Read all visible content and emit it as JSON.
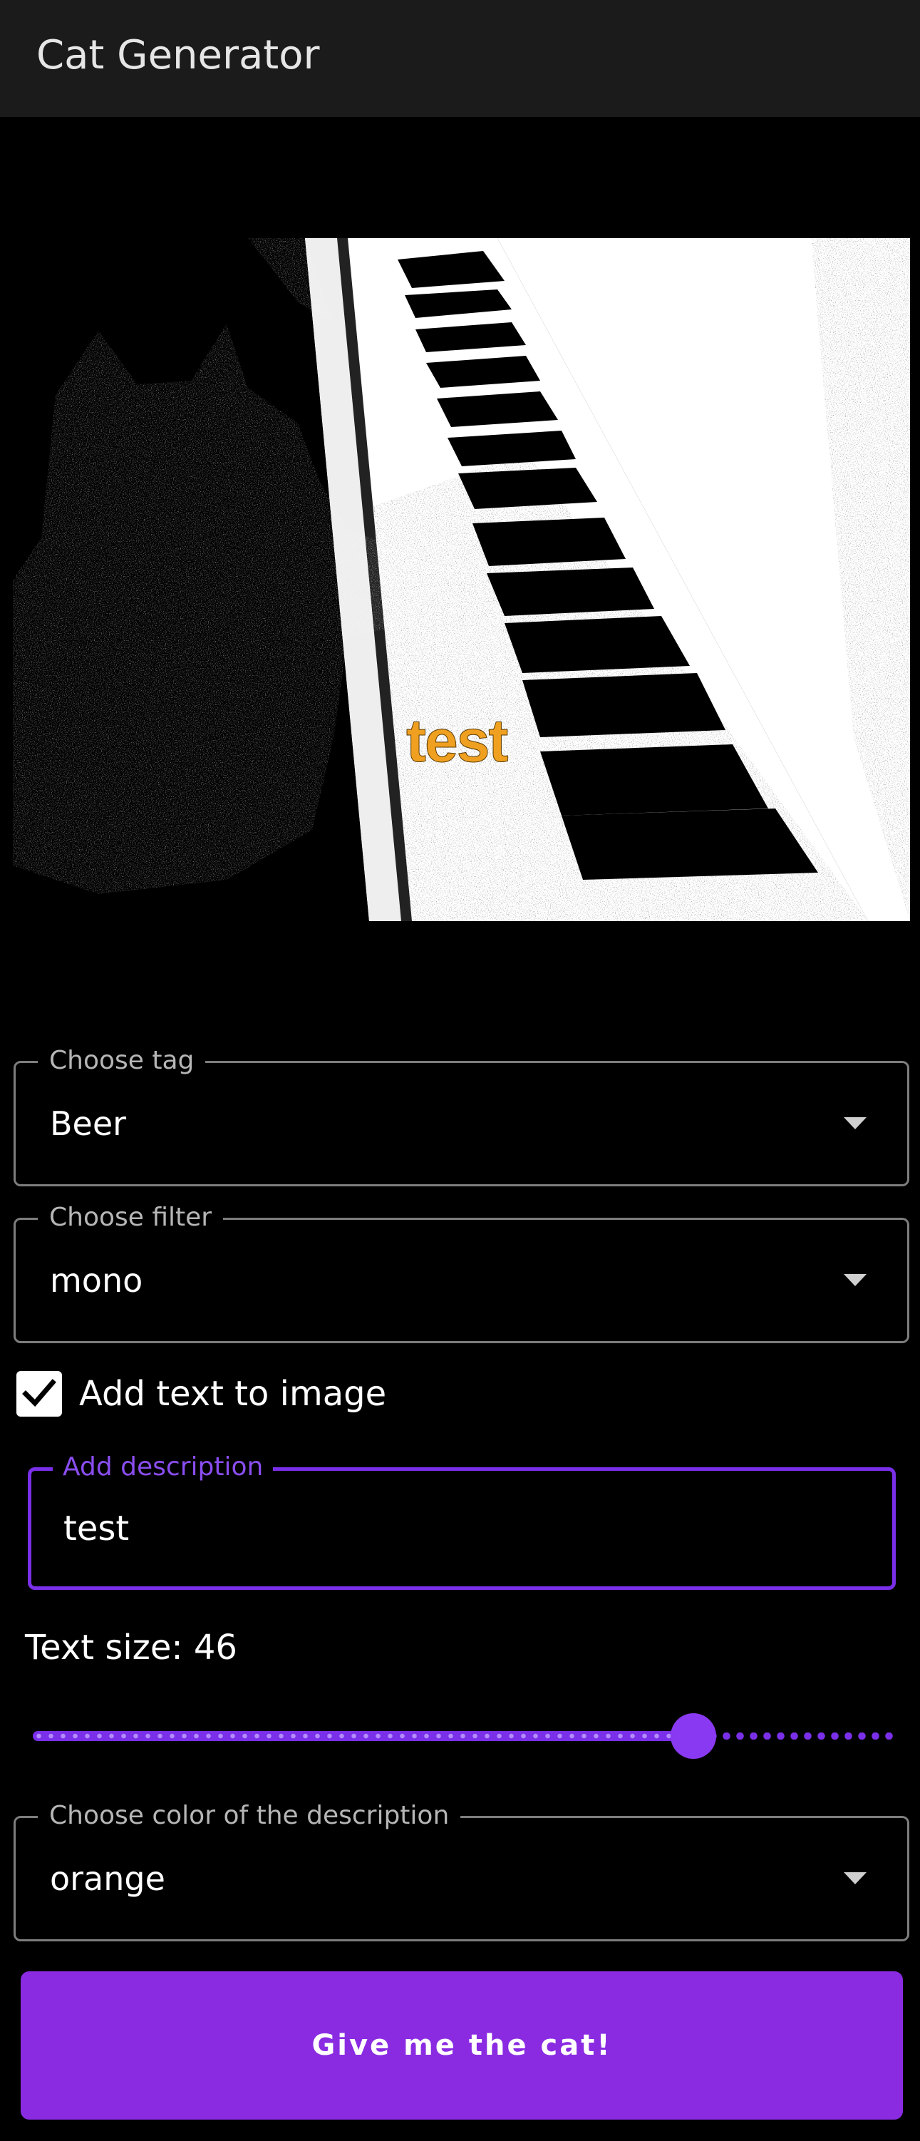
{
  "appbar": {
    "title": "Cat Generator"
  },
  "preview": {
    "overlay_text": "test",
    "overlay_color": "#f0a020"
  },
  "tag_select": {
    "label": "Choose tag",
    "value": "Beer"
  },
  "filter_select": {
    "label": "Choose filter",
    "value": "mono"
  },
  "add_text": {
    "label": "Add text to image",
    "checked": true
  },
  "description": {
    "label": "Add description",
    "value": "test"
  },
  "text_size": {
    "label": "Text size: 46",
    "value": 46
  },
  "color_select": {
    "label": "Choose color of the description",
    "value": "orange"
  },
  "submit": {
    "label": "Give me the cat!"
  },
  "colors": {
    "accent": "#8a2be2",
    "appbar_bg": "#1b1b1b",
    "background": "#000000",
    "outline": "#7d7d7d"
  }
}
